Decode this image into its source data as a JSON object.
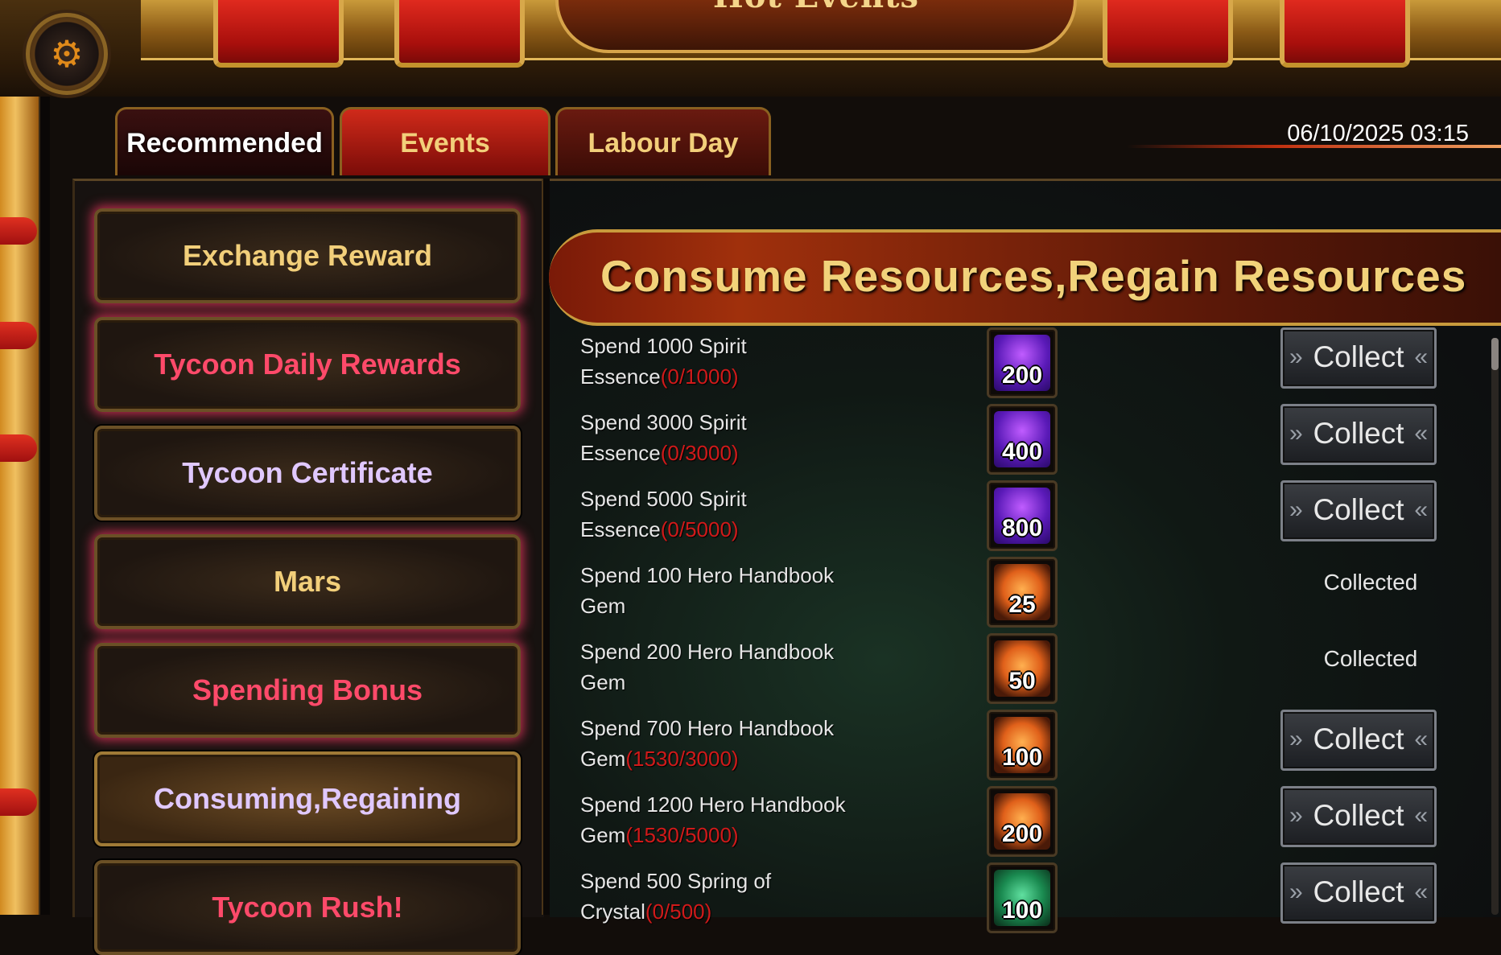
{
  "window": {
    "title": "Hot Events"
  },
  "tabs": [
    {
      "label": "Recommended",
      "active": true
    },
    {
      "label": "Events",
      "active": false
    },
    {
      "label": "Labour Day",
      "active": false
    }
  ],
  "timestamp": "06/10/2025 03:15",
  "menu": {
    "items": [
      {
        "label": "Exchange Reward",
        "color": "#f2cf7a"
      },
      {
        "label": "Tycoon Daily Rewards",
        "color": "#ff4a6a"
      },
      {
        "label": "Tycoon Certificate",
        "color": "#e0c8ff"
      },
      {
        "label": "Mars",
        "color": "#f2cf7a"
      },
      {
        "label": "Spending Bonus",
        "color": "#ff4a6a"
      },
      {
        "label": "Consuming,Regaining",
        "color": "#e0c8ff"
      },
      {
        "label": "Tycoon Rush!",
        "color": "#ff4a6a"
      }
    ]
  },
  "content": {
    "title": "Consume Resources,Regain Resources",
    "rows": [
      {
        "line1": "Spend 1000 Spirit",
        "line2": "Essence",
        "progress": "(0/1000)",
        "reward": "200",
        "gem": "purple",
        "status": "collect",
        "button": "Collect"
      },
      {
        "line1": "Spend 3000 Spirit",
        "line2": "Essence",
        "progress": "(0/3000)",
        "reward": "400",
        "gem": "purple",
        "status": "collect",
        "button": "Collect"
      },
      {
        "line1": "Spend 5000 Spirit",
        "line2": "Essence",
        "progress": "(0/5000)",
        "reward": "800",
        "gem": "purple",
        "status": "collect",
        "button": "Collect"
      },
      {
        "line1": "Spend 100 Hero Handbook",
        "line2": "Gem",
        "progress": "",
        "reward": "25",
        "gem": "orange",
        "status": "collected",
        "button": "Collected"
      },
      {
        "line1": "Spend 200 Hero Handbook",
        "line2": "Gem",
        "progress": "",
        "reward": "50",
        "gem": "orange",
        "status": "collected",
        "button": "Collected"
      },
      {
        "line1": "Spend 700 Hero Handbook",
        "line2": "Gem",
        "progress": "(1530/3000)",
        "reward": "100",
        "gem": "orange",
        "status": "collect",
        "button": "Collect"
      },
      {
        "line1": "Spend 1200 Hero Handbook",
        "line2": "Gem",
        "progress": "(1530/5000)",
        "reward": "200",
        "gem": "orange",
        "status": "collect",
        "button": "Collect"
      },
      {
        "line1": "Spend 500 Spring of",
        "line2": "Crystal",
        "progress": "(0/500)",
        "reward": "100",
        "gem": "green",
        "status": "collect",
        "button": "Collect"
      }
    ]
  }
}
